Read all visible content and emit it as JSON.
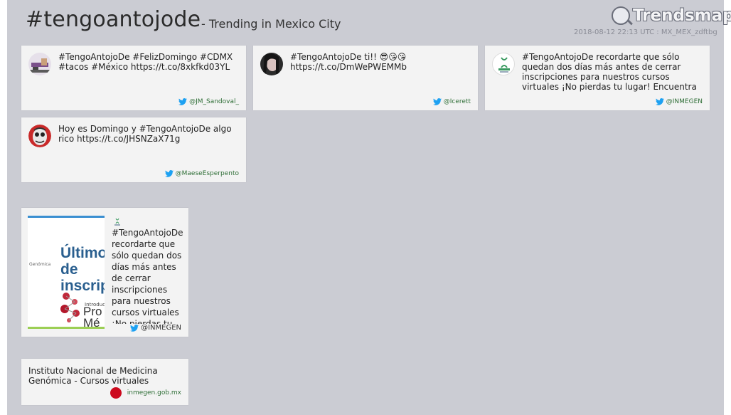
{
  "header": {
    "hashtag": "#tengoantojode",
    "subtitle": "- Trending in Mexico City",
    "logo_text": "Trendsmap",
    "meta": "2018-08-12 22:13 UTC : MX_MEX_zdftbg"
  },
  "tweets": [
    {
      "text": "#TengoAntojoDe        #FelizDomingo #CDMX #tacos #México https://t.co/8xkfkd03YL",
      "author": "@JM_Sandoval_",
      "avatar": "avatar-photo"
    },
    {
      "text": "#TengoAntojoDe ti!! 😎😘😘 https://t.co/DmWePWEMMb",
      "author": "@Icerett",
      "avatar": "avatar-photo"
    },
    {
      "text": "#TengoAntojoDe recordarte que sólo quedan dos días más antes de cerrar inscripciones para nuestros cursos virtuales ¡No pierdas tu lugar! Encuentra toda la información aquí",
      "author": "@INMEGEN",
      "avatar": "inmegen-logo"
    },
    {
      "text": "Hoy es Domingo y #TengoAntojoDe algo rico https://t.co/JHSNZaX71g",
      "author": "@MaeseEsperpento",
      "avatar": "avatar-illustration"
    }
  ],
  "image_card": {
    "text": "#TengoAntojoDe recordarte que sólo quedan dos días más antes de cerrar inscripciones para nuestros cursos virtuales ¡No pierdas tu lugar!",
    "author": "@INMEGEN",
    "thumb_title": "Últimos de inscripc",
    "thumb_small": "Genómica",
    "thumb_sub": "Introduc",
    "thumb_big": "Pro Mé"
  },
  "link_card": {
    "title": "Instituto Nacional de Medicina Genómica - Cursos virtuales",
    "site": "inmegen.gob.mx"
  },
  "colors": {
    "panel": "#cbccd3",
    "card": "#f3f3f3",
    "twitter_bird": "#1da1f2",
    "author_link": "#2e6e36",
    "favicon": "#cc0a1e"
  }
}
